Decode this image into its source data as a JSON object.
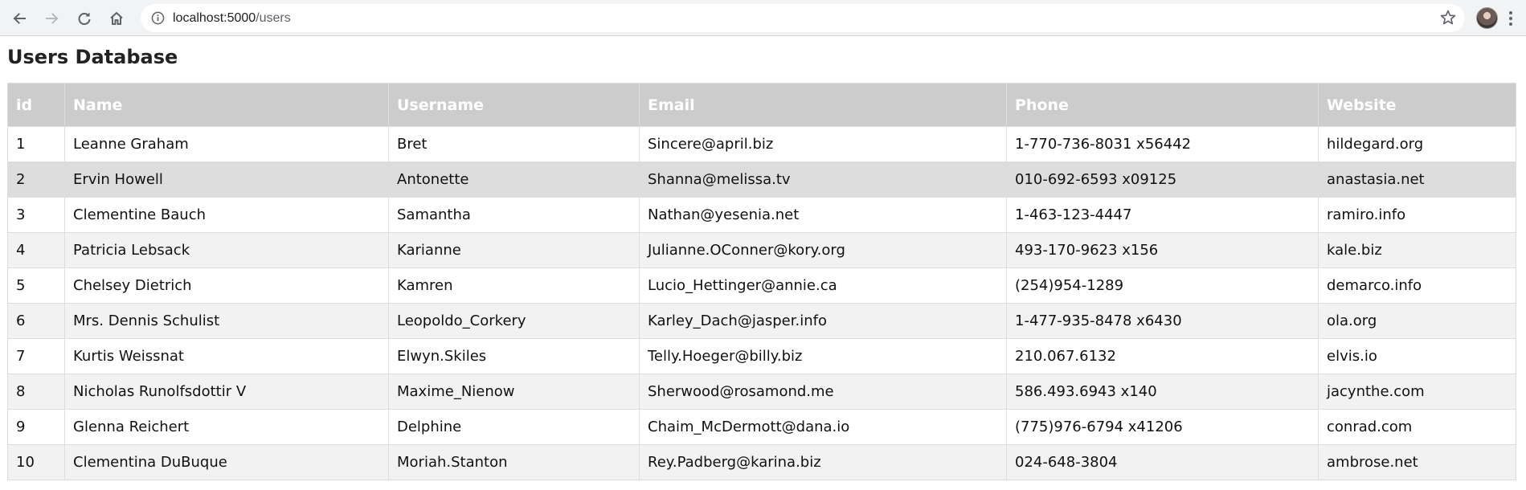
{
  "browser": {
    "url_host": "localhost:5000",
    "url_path": "/users"
  },
  "page": {
    "title": "Users Database"
  },
  "table": {
    "columns": [
      "id",
      "Name",
      "Username",
      "Email",
      "Phone",
      "Website"
    ],
    "rows": [
      [
        "1",
        "Leanne Graham",
        "Bret",
        "Sincere@april.biz",
        "1-770-736-8031 x56442",
        "hildegard.org"
      ],
      [
        "2",
        "Ervin Howell",
        "Antonette",
        "Shanna@melissa.tv",
        "010-692-6593 x09125",
        "anastasia.net"
      ],
      [
        "3",
        "Clementine Bauch",
        "Samantha",
        "Nathan@yesenia.net",
        "1-463-123-4447",
        "ramiro.info"
      ],
      [
        "4",
        "Patricia Lebsack",
        "Karianne",
        "Julianne.OConner@kory.org",
        "493-170-9623 x156",
        "kale.biz"
      ],
      [
        "5",
        "Chelsey Dietrich",
        "Kamren",
        "Lucio_Hettinger@annie.ca",
        "(254)954-1289",
        "demarco.info"
      ],
      [
        "6",
        "Mrs. Dennis Schulist",
        "Leopoldo_Corkery",
        "Karley_Dach@jasper.info",
        "1-477-935-8478 x6430",
        "ola.org"
      ],
      [
        "7",
        "Kurtis Weissnat",
        "Elwyn.Skiles",
        "Telly.Hoeger@billy.biz",
        "210.067.6132",
        "elvis.io"
      ],
      [
        "8",
        "Nicholas Runolfsdottir V",
        "Maxime_Nienow",
        "Sherwood@rosamond.me",
        "586.493.6943 x140",
        "jacynthe.com"
      ],
      [
        "9",
        "Glenna Reichert",
        "Delphine",
        "Chaim_McDermott@dana.io",
        "(775)976-6794 x41206",
        "conrad.com"
      ],
      [
        "10",
        "Clementina DuBuque",
        "Moriah.Stanton",
        "Rey.Padberg@karina.biz",
        "024-648-3804",
        "ambrose.net"
      ]
    ],
    "highlighted_row_index": 1
  },
  "icons": {
    "back": "arrow-left-icon",
    "forward": "arrow-right-icon",
    "reload": "reload-icon",
    "home": "home-icon",
    "info": "info-icon",
    "bookmark": "star-icon",
    "menu": "kebab-menu-icon"
  },
  "colors": {
    "header_bg": "#cccccc",
    "header_text": "#ffffff",
    "stripe_bg": "#f2f2f2",
    "hover_bg": "#dddddd",
    "border": "#dddddd"
  }
}
